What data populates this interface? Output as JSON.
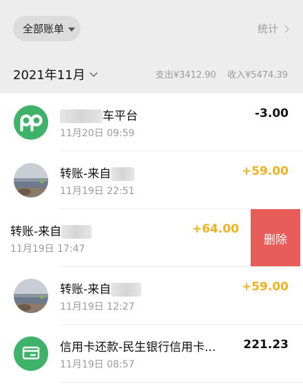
{
  "header": {
    "filter_label": "全部账单",
    "stats_label": "统计"
  },
  "month": {
    "label": "2021年11月",
    "expense": "支出¥3412.90",
    "income": "收入¥5474.39"
  },
  "transactions": [
    {
      "title": "车平台",
      "time": "11月20日 09:59",
      "amount": "-3.00",
      "icon": "pp-app-icon"
    },
    {
      "title": "转账-来自",
      "time": "11月19日 22:51",
      "amount": "+59.00",
      "icon": "landscape-avatar"
    },
    {
      "title": "转账-来自",
      "time": "11月19日 17:47",
      "amount": "+64.00",
      "delete_label": "删除"
    },
    {
      "title": "转账-来自",
      "time": "11月19日 12:27",
      "amount": "+59.00",
      "icon": "landscape-avatar"
    },
    {
      "title": "信用卡还款-民生银行信用卡...",
      "time": "11月19日 08:57",
      "amount": "221.23",
      "icon": "credit-card-icon"
    }
  ],
  "colors": {
    "positive": "#f2b21d",
    "delete": "#e85d5a",
    "icon_green": "#3fb26a"
  }
}
